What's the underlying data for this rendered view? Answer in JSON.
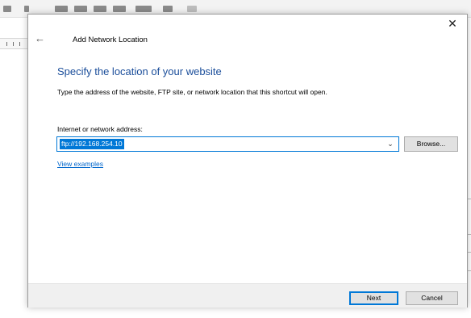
{
  "dialog": {
    "title": "Add Network Location",
    "heading": "Specify the location of your website",
    "description": "Type the address of the website, FTP site, or network location that this shortcut will open.",
    "address_label": "Internet or network address:",
    "address_value": "ftp://192.168.254.10",
    "browse_label": "Browse...",
    "examples_link": "View examples",
    "next_label": "Next",
    "cancel_label": "Cancel",
    "close_glyph": "✕",
    "back_glyph": "←",
    "dropdown_glyph": "⌄"
  },
  "colors": {
    "accent": "#0078d7",
    "heading": "#1a4d9a",
    "link": "#0066cc"
  }
}
